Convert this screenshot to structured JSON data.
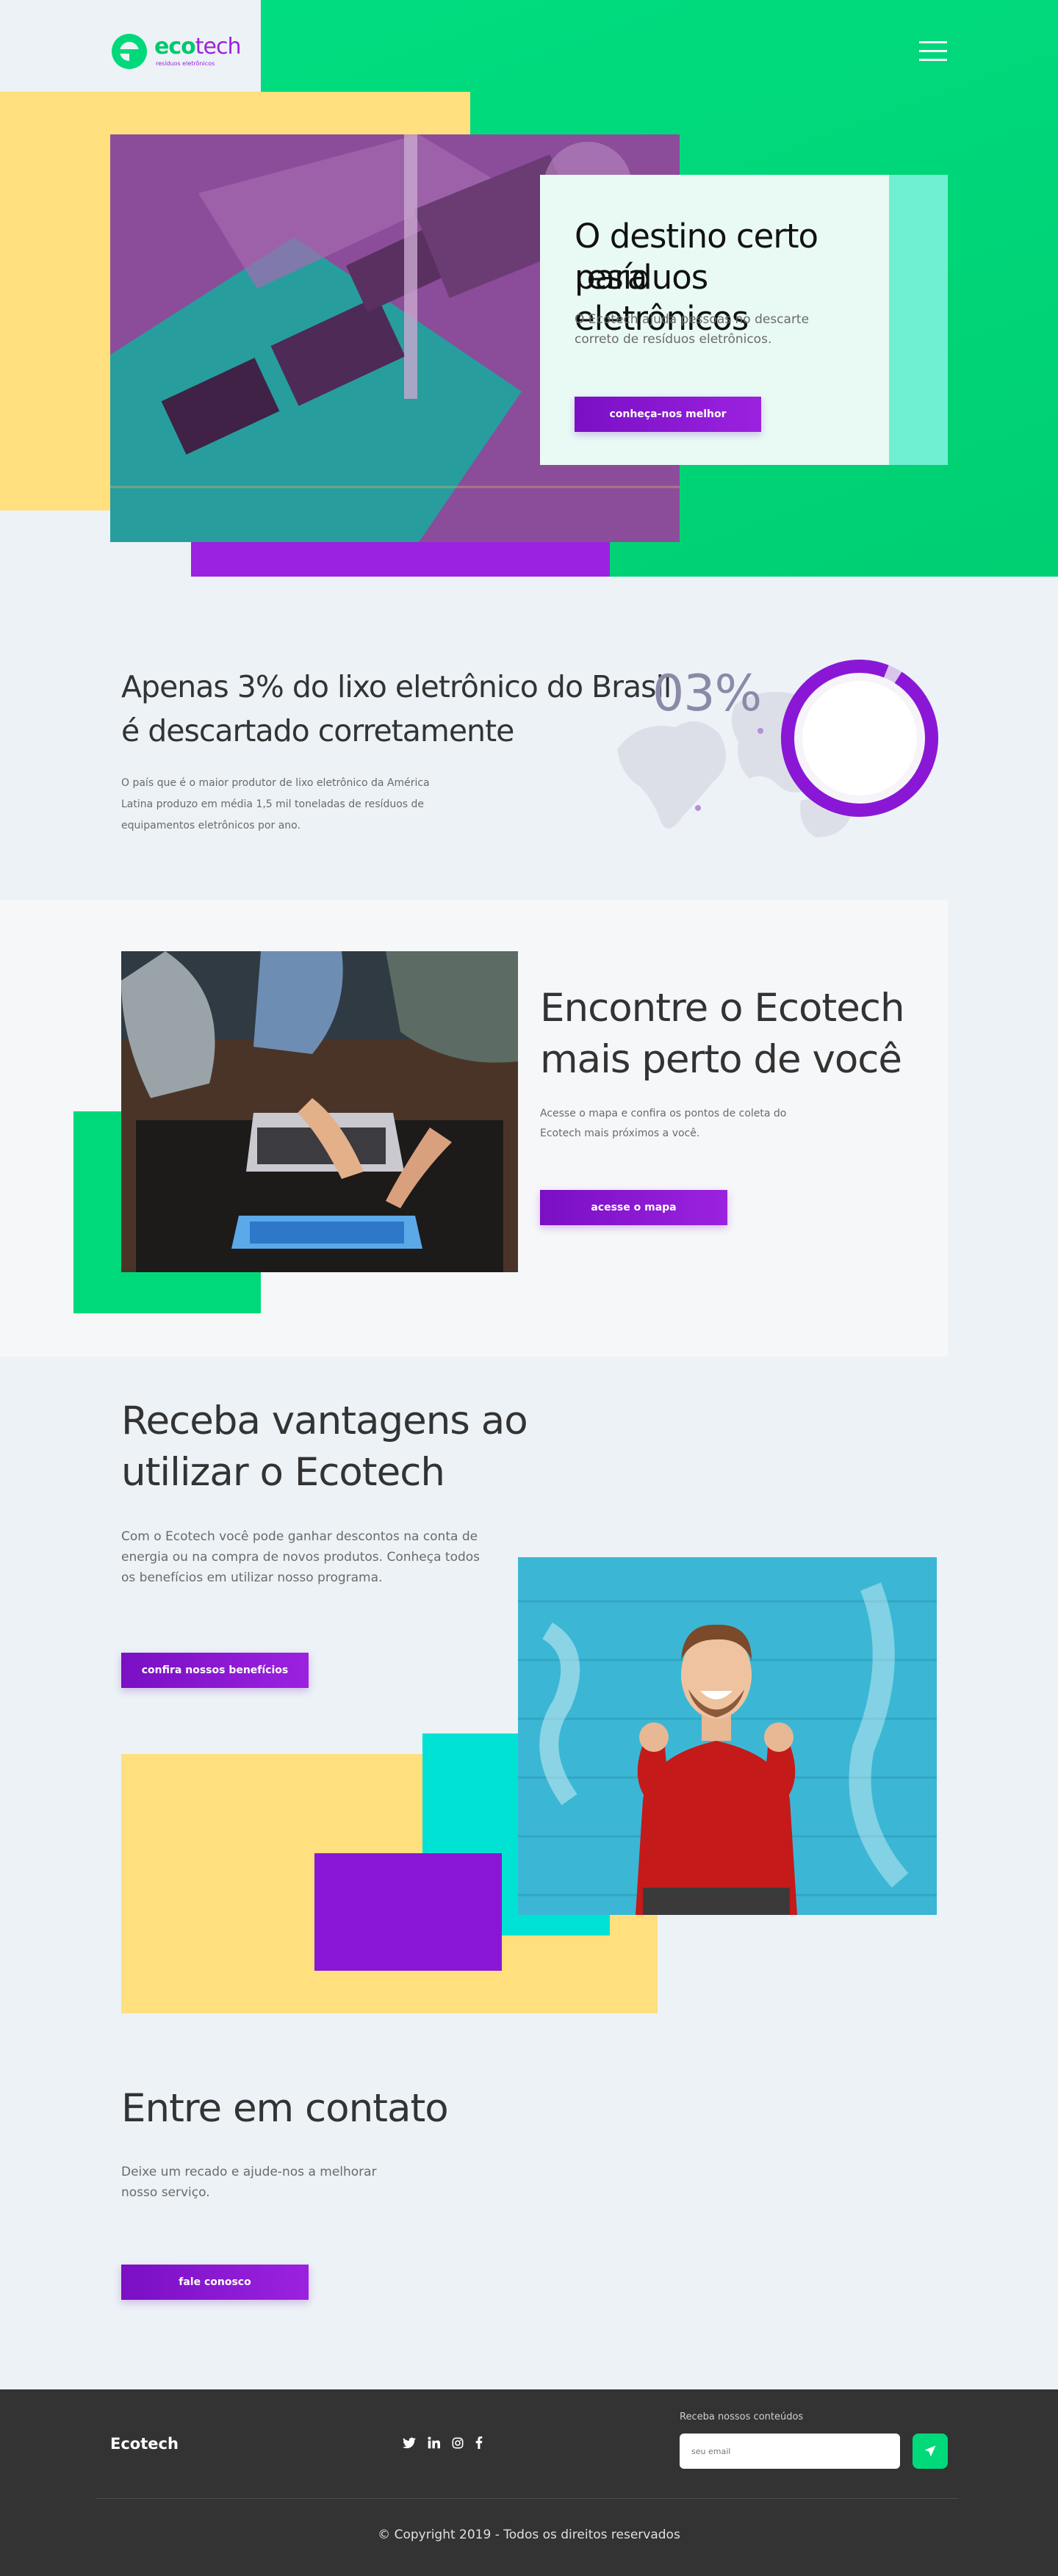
{
  "colors": {
    "green": "#00d97a",
    "purple": "#8a17d6",
    "yellow": "#ffdf7e",
    "teal": "#00e2d4",
    "dark": "#333333"
  },
  "header": {
    "logo_text_a": "eco",
    "logo_text_b": "tech",
    "logo_tagline": "resíduos eletrônicos",
    "menu_icon": "hamburger-menu-icon"
  },
  "hero": {
    "title_line1": "O destino certo para",
    "title_line2": "resíduos eletrônicos",
    "text_line1": "O Ecotech ajuda pessoas no descarte",
    "text_line2": "correto de resíduos eletrônicos.",
    "button": "conheça-nos melhor"
  },
  "stats": {
    "title_line1": "Apenas 3% do lixo eletrônico do Brasil",
    "title_line2": "é descartado corretamente",
    "text_line1": "O país que é o maior produtor de lixo eletrônico da América",
    "text_line2": "Latina produzo em média 1,5 mil toneladas de resíduos de",
    "text_line3": "equipamentos eletrônicos por ano.",
    "percent_label": "03%",
    "percent_value": 3
  },
  "find": {
    "title_line1": "Encontre o Ecotech",
    "title_line2": "mais perto de você",
    "text_line1": "Acesse o mapa e confira os pontos de coleta do",
    "text_line2": "Ecotech mais próximos a você.",
    "button": "acesse o mapa"
  },
  "benefits": {
    "title_line1": "Receba vantagens ao",
    "title_line2": "utilizar o Ecotech",
    "text_line1": "Com o Ecotech você pode ganhar descontos na conta de",
    "text_line2": "energia ou na compra de novos produtos. Conheça todos",
    "text_line3": "os benefícios em utilizar nosso programa.",
    "button": "confira nossos benefícios"
  },
  "contact": {
    "title": "Entre em contato",
    "text_line1": "Deixe um recado e ajude-nos a melhorar",
    "text_line2": "nosso serviço.",
    "button": "fale conosco"
  },
  "footer": {
    "brand": "Ecotech",
    "social": [
      "twitter-icon",
      "linkedin-icon",
      "instagram-icon",
      "facebook-icon"
    ],
    "newsletter_label": "Receba nossos conteúdos",
    "newsletter_placeholder": "seu email",
    "copyright": "© Copyright 2019 - Todos os direitos reservados"
  }
}
